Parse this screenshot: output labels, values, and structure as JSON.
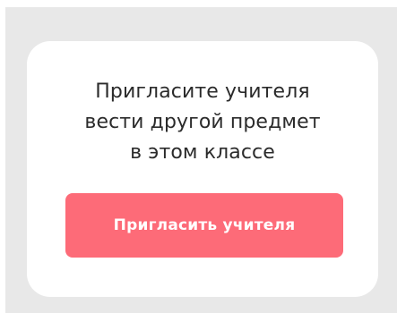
{
  "card": {
    "message_lines": [
      "Пригласите учителя",
      "вести другой предмет",
      "в этом классе"
    ],
    "button_label": "Пригласить учителя"
  },
  "colors": {
    "backdrop": "#e8e8e8",
    "card": "#ffffff",
    "text": "#2b2b2b",
    "button": "#fd6b78",
    "button_text": "#ffffff"
  }
}
